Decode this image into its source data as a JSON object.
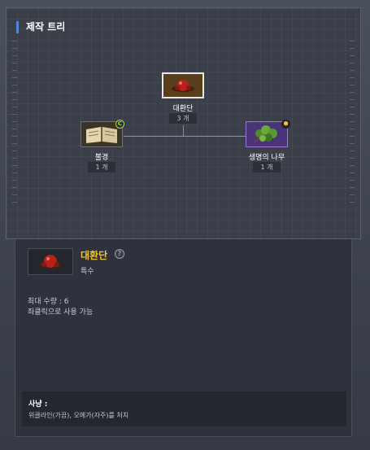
{
  "panel_title": "제작 트리",
  "tree": {
    "target": {
      "name": "대환단",
      "count": "3 개",
      "icon": "red-pill-icon"
    },
    "ingredients": [
      {
        "name": "불경",
        "count": "1 개",
        "icon": "open-book-icon",
        "badge": "C",
        "badge_color": "#9be13a"
      },
      {
        "name": "생명의 나무",
        "count": "1 개",
        "icon": "tree-branch-icon",
        "badge": "⬢",
        "badge_color": "#f0c030",
        "frame_color": "#9b76d8"
      }
    ]
  },
  "detail": {
    "name": "대환단",
    "name_color": "#f0c030",
    "help": "?",
    "type": "특수",
    "max_qty": "최대 수량 : 6",
    "usage": "좌클릭으로 사용 가능",
    "source_title": "사냥 :",
    "source_text": "위클라인(가끔), 오메가(자주)를 처치"
  }
}
